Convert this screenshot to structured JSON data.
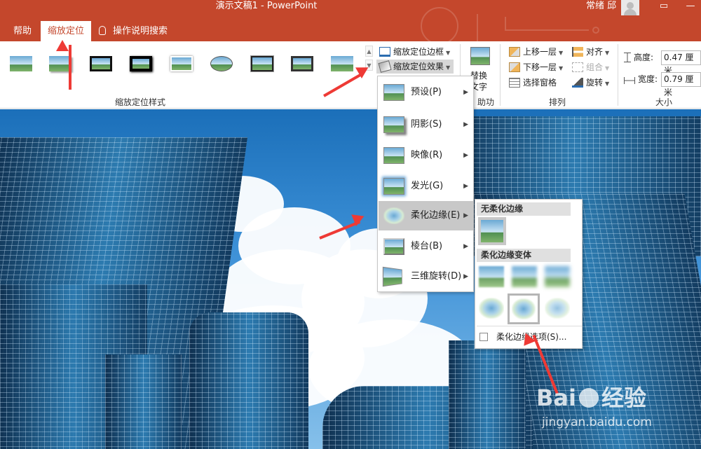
{
  "titlebar": {
    "title": "演示文稿1  -  PowerPoint",
    "user": "常绪 邱",
    "restore_icon": "▭",
    "minimize_icon": "—"
  },
  "tabs": [
    {
      "label": "帮助"
    },
    {
      "label": "缩放定位",
      "active": true
    },
    {
      "label": "操作说明搜索",
      "icon": "lightbulb-icon"
    }
  ],
  "ribbon": {
    "styles_group_label": "缩放定位样式",
    "zoom_border_label": "缩放定位边框",
    "zoom_effect_label": "缩放定位效果",
    "alt_text_label_line1": "替换",
    "alt_text_label_line2": "文字",
    "accessibility_group_label": "助功能",
    "arrange_group_label": "排列",
    "bring_forward_label": "上移一层",
    "send_backward_label": "下移一层",
    "selection_pane_label": "选择窗格",
    "align_label": "对齐",
    "group_label": "组合",
    "rotate_label": "旋转",
    "size_group_label": "大小",
    "height_label": "高度:",
    "height_value": "0.47 厘米",
    "width_label": "宽度:",
    "width_value": "0.79 厘米"
  },
  "effect_menu": {
    "items": [
      {
        "label": "预设(P)"
      },
      {
        "label": "阴影(S)"
      },
      {
        "label": "映像(R)"
      },
      {
        "label": "发光(G)"
      },
      {
        "label": "柔化边缘(E)",
        "active": true
      },
      {
        "label": "棱台(B)"
      },
      {
        "label": "三维旋转(D)"
      }
    ]
  },
  "soft_edge_submenu": {
    "no_soft_edge_header": "无柔化边缘",
    "variants_header": "柔化边缘变体",
    "options_label": "柔化边缘选项(S)..."
  },
  "watermark": {
    "brand": "Bai",
    "brand_suffix": "经验",
    "url": "jingyan.baidu.com"
  },
  "colors": {
    "accent": "#c4472c",
    "arrow": "#ee3a35",
    "menu_highlight": "#c8c8c8"
  }
}
